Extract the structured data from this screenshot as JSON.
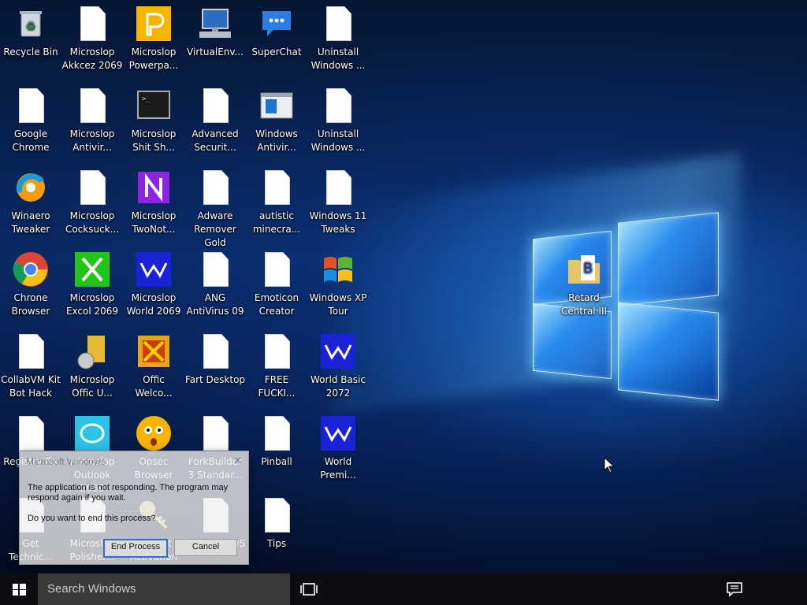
{
  "desktop": {
    "icons": [
      {
        "label": "Recycle Bin",
        "icon": "recycle-bin"
      },
      {
        "label": "Microslop Akkcez 2069",
        "icon": "document"
      },
      {
        "label": "Microslop Powerpa...",
        "icon": "powerpoint"
      },
      {
        "label": "VirtualEnv...",
        "icon": "computer"
      },
      {
        "label": "SuperChat",
        "icon": "chat"
      },
      {
        "label": "Uninstall Windows ...",
        "icon": "document"
      },
      {
        "label": "Google Chrome",
        "icon": "document"
      },
      {
        "label": "Microslop Antivir...",
        "icon": "document"
      },
      {
        "label": "Microslop Shit Sh...",
        "icon": "terminal"
      },
      {
        "label": "Advanced Securit...",
        "icon": "document"
      },
      {
        "label": "Windows Antivir...",
        "icon": "window-app"
      },
      {
        "label": "Uninstall Windows ...",
        "icon": "document"
      },
      {
        "label": "Winaero Tweaker",
        "icon": "winaero"
      },
      {
        "label": "Microslop Cocksuck...",
        "icon": "document"
      },
      {
        "label": "Microslop TwoNot...",
        "icon": "onenote"
      },
      {
        "label": "Adware Remover Gold",
        "icon": "document"
      },
      {
        "label": "autistic minecra...",
        "icon": "document"
      },
      {
        "label": "Windows 11 Tweaks",
        "icon": "document"
      },
      {
        "label": "Chrone Browser",
        "icon": "chrome"
      },
      {
        "label": "Microslop Excol 2069",
        "icon": "excel"
      },
      {
        "label": "Microslop World 2069",
        "icon": "word"
      },
      {
        "label": "ANG AntiVirus 09",
        "icon": "document"
      },
      {
        "label": "Emoticon Creator",
        "icon": "document"
      },
      {
        "label": "Windows XP Tour",
        "icon": "windows-xp"
      },
      {
        "label": "CollabVM Kit Bot Hack",
        "icon": "document"
      },
      {
        "label": "Microslop Offic U...",
        "icon": "office-update"
      },
      {
        "label": "Offic Welco...",
        "icon": "office"
      },
      {
        "label": "Fart Desktop",
        "icon": "document"
      },
      {
        "label": "FREE FUCKI...",
        "icon": "document"
      },
      {
        "label": "World Basic 2072",
        "icon": "word"
      },
      {
        "label": "Registry Fix",
        "icon": "document"
      },
      {
        "label": "Microslop Outlook 2069",
        "icon": "outlook"
      },
      {
        "label": "Opsec Browser",
        "icon": "emoji"
      },
      {
        "label": "ForkBuilder 3 Standar...",
        "icon": "document"
      },
      {
        "label": "Pinball",
        "icon": "document"
      },
      {
        "label": "World Premi...",
        "icon": "word"
      },
      {
        "label": "Get Technic...",
        "icon": "document"
      },
      {
        "label": "Microslop Polisher...",
        "icon": "document"
      },
      {
        "label": "Product Activation",
        "icon": "key"
      },
      {
        "label": "Office Pro v5",
        "icon": "document"
      },
      {
        "label": "Tips",
        "icon": "document"
      },
      {
        "label": "Retard Central III",
        "icon": "folder-app"
      }
    ]
  },
  "dialog": {
    "title": "Microsoft Windows",
    "message": "The application is not responding. The program may respond again if you wait.",
    "question": "Do you want to end this process?",
    "end_button": "End Process",
    "cancel_button": "Cancel"
  },
  "taskbar": {
    "search_placeholder": "Search Windows"
  }
}
